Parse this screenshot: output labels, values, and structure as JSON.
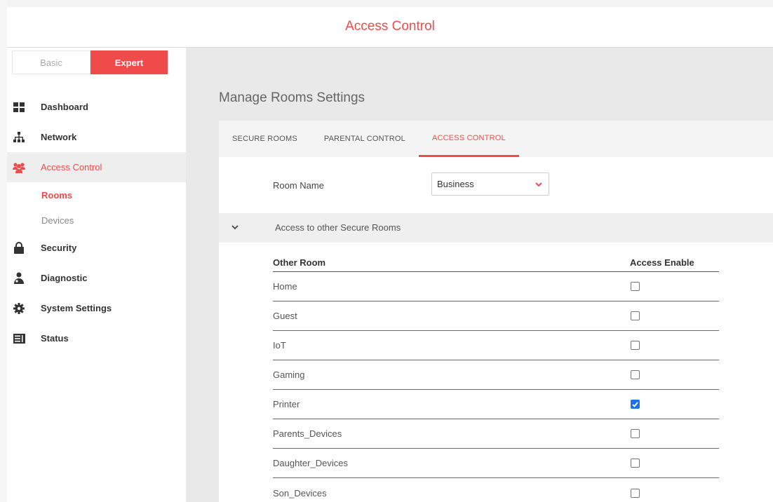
{
  "header": {
    "title": "Access Control"
  },
  "mode": {
    "basic_label": "Basic",
    "expert_label": "Expert",
    "selected": "Expert"
  },
  "sidebar": {
    "items": [
      {
        "label": "Dashboard",
        "icon": "dashboard-grid-icon"
      },
      {
        "label": "Network",
        "icon": "network-tree-icon"
      },
      {
        "label": "Access Control",
        "icon": "users-group-icon",
        "active": true,
        "children": [
          {
            "label": "Rooms",
            "active": true
          },
          {
            "label": "Devices"
          }
        ]
      },
      {
        "label": "Security",
        "icon": "lock-icon"
      },
      {
        "label": "Diagnostic",
        "icon": "doctor-icon"
      },
      {
        "label": "System Settings",
        "icon": "gear-icon"
      },
      {
        "label": "Status",
        "icon": "status-list-icon"
      }
    ]
  },
  "main": {
    "page_title": "Manage Rooms Settings",
    "tabs": [
      {
        "label": "SECURE ROOMS"
      },
      {
        "label": "PARENTAL CONTROL"
      },
      {
        "label": "ACCESS CONTROL",
        "active": true
      }
    ],
    "room_name_label": "Room Name",
    "room_name_value": "Business",
    "section_title": "Access to other Secure Rooms",
    "table": {
      "headers": [
        "Other Room",
        "Access Enable"
      ],
      "rows": [
        {
          "room": "Home",
          "enabled": false
        },
        {
          "room": "Guest",
          "enabled": false
        },
        {
          "room": "IoT",
          "enabled": false
        },
        {
          "room": "Gaming",
          "enabled": false
        },
        {
          "room": "Printer",
          "enabled": true
        },
        {
          "room": "Parents_Devices",
          "enabled": false
        },
        {
          "room": "Daughter_Devices",
          "enabled": false
        },
        {
          "room": "Son_Devices",
          "enabled": false
        }
      ]
    }
  },
  "colors": {
    "accent": "#ef4b4b",
    "checkbox_checked": "#1a73e8",
    "content_bg": "#e9e9e9"
  }
}
